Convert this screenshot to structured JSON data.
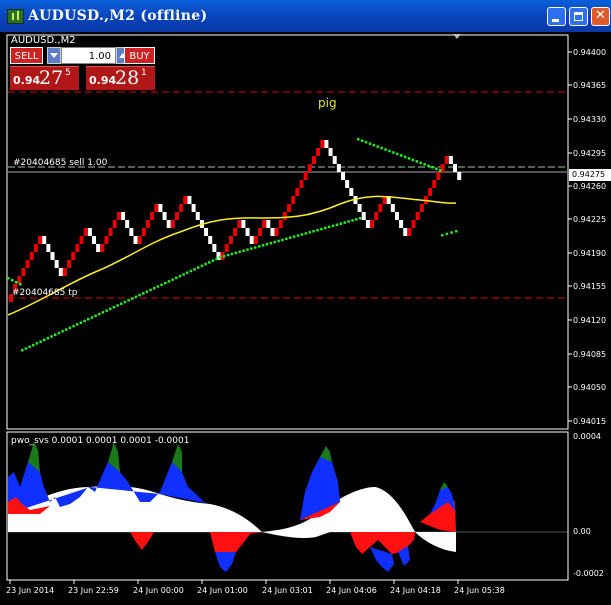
{
  "window": {
    "title": "AUDUSD.,M2 (offline)"
  },
  "chart": {
    "symbol_label": "AUDUSD.,M2",
    "pig_label": "pig",
    "sell_line_label": "#20404685 sell 1.00",
    "tp_label": "#20404685 tp",
    "current_price": "0.94275",
    "y_labels": [
      "0.94400",
      "0.94365",
      "0.94330",
      "0.94295",
      "0.94260",
      "0.94225",
      "0.94190",
      "0.94155",
      "0.94120",
      "0.94085",
      "0.94050",
      "0.94015"
    ],
    "x_labels": [
      "23 Jun 2014",
      "23 Jun 22:59",
      "24 Jun 00:00",
      "24 Jun 01:00",
      "24 Jun 03:01",
      "24 Jun 04:06",
      "24 Jun 04:18",
      "24 Jun 05:38"
    ]
  },
  "one_click": {
    "sell_label": "SELL",
    "buy_label": "BUY",
    "lot_value": "1.00",
    "sell_price": {
      "small": "0.94",
      "big": "27",
      "sup": "5"
    },
    "buy_price": {
      "small": "0.94",
      "big": "28",
      "sup": "1"
    }
  },
  "indicator": {
    "label": "pwo_svs 0.0001 0.0001 0.0001 -0.0001",
    "y_labels": [
      "0.0004",
      "0.00",
      "-0.0002"
    ]
  },
  "colors": {
    "bull": "#e60000",
    "bear": "#ffffff",
    "ma": "#ffee22",
    "dots": "#22ee22",
    "sell_line": "#99cc99",
    "tp_line": "#dd0000",
    "ind_red": "#ff1010",
    "ind_blue": "#1030ff",
    "ind_green": "#1a7a1a",
    "ind_white": "#ffffff"
  }
}
